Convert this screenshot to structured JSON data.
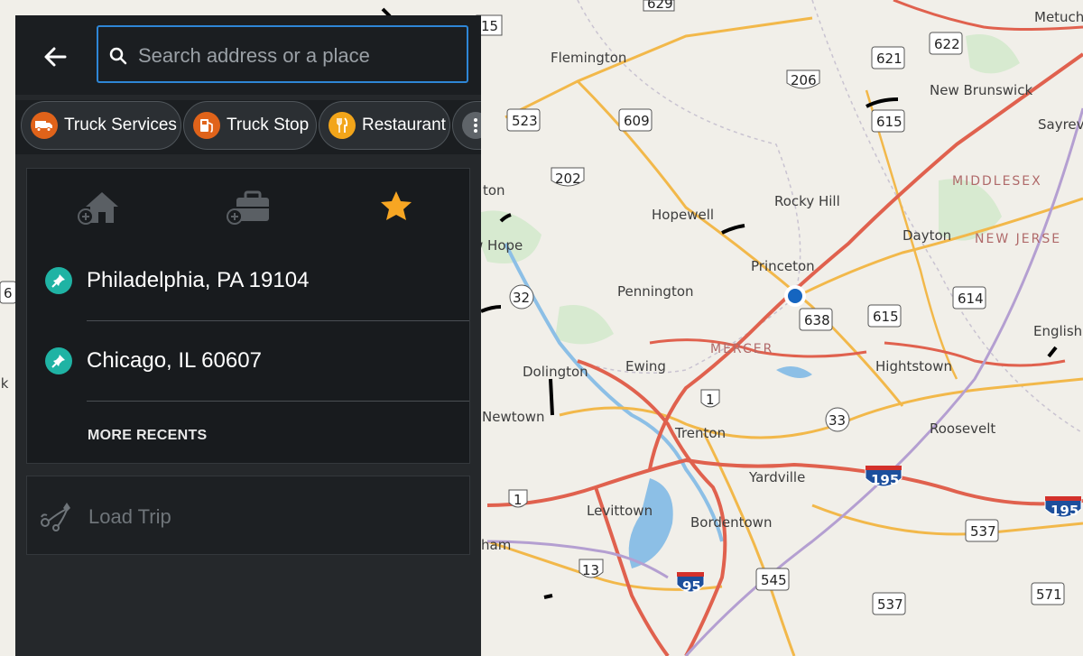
{
  "search": {
    "placeholder": "Search address or a place"
  },
  "categories": [
    {
      "label": "Truck Services",
      "icon": "truck-icon"
    },
    {
      "label": "Truck Stop",
      "icon": "fuel-pump-icon"
    },
    {
      "label": "Restaurant",
      "icon": "fork-knife-icon"
    }
  ],
  "quick_access": {
    "home": "add-home-icon",
    "work": "add-work-icon",
    "favorites": "star-icon"
  },
  "recents": [
    {
      "label": "Philadelphia, PA 19104"
    },
    {
      "label": "Chicago, IL 60607"
    }
  ],
  "more_recents_label": "MORE RECENTS",
  "load_trip_label": "Load Trip",
  "map": {
    "places": [
      "Flemington",
      "Metuch",
      "New Brunswick",
      "Sayrev",
      "Rocky Hill",
      "Hopewell",
      "Princeton",
      "Dayton",
      "Pennington",
      "Ewing",
      "Dolington",
      "Trenton",
      "Hightstown",
      "Roosevelt",
      "Newtown",
      "Yardville",
      "Levittown",
      "Bordentown",
      "English",
      "ton",
      "w Hope",
      "ham",
      "enk"
    ],
    "regions": [
      "MIDDLESEX",
      "NEW JERSE",
      "MERCER"
    ],
    "route_shields": [
      "629",
      "15",
      "622",
      "621",
      "206",
      "615",
      "523",
      "609",
      "202",
      "32",
      "638",
      "615",
      "614",
      "1",
      "33",
      "1",
      "13",
      "545",
      "537",
      "537",
      "571"
    ],
    "interstates": [
      "195",
      "195",
      "95"
    ],
    "edge_digit": "6",
    "colors": {
      "highway": "#e0614e",
      "arterial": "#f2b84a",
      "water": "#8cbfe6",
      "park": "#d7ead0",
      "location_dot": "#1565c0"
    }
  }
}
